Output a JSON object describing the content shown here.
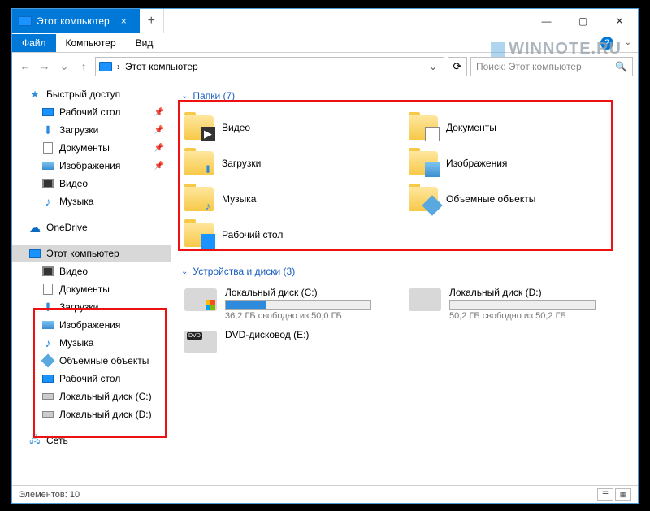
{
  "title": "Этот компьютер",
  "watermark": "WINNOTE.RU",
  "ribbon": {
    "file": "Файл",
    "computer": "Компьютер",
    "view": "Вид"
  },
  "address": {
    "text": "Этот компьютер"
  },
  "search": {
    "placeholder": "Поиск: Этот компьютер"
  },
  "sidebar": {
    "quick": "Быстрый доступ",
    "quick_items": [
      {
        "label": "Рабочий стол"
      },
      {
        "label": "Загрузки"
      },
      {
        "label": "Документы"
      },
      {
        "label": "Изображения"
      },
      {
        "label": "Видео"
      },
      {
        "label": "Музыка"
      }
    ],
    "onedrive": "OneDrive",
    "thispc": "Этот компьютер",
    "pc_items": [
      {
        "label": "Видео"
      },
      {
        "label": "Документы"
      },
      {
        "label": "Загрузки"
      },
      {
        "label": "Изображения"
      },
      {
        "label": "Музыка"
      },
      {
        "label": "Объемные объекты"
      },
      {
        "label": "Рабочий стол"
      }
    ],
    "drives": [
      {
        "label": "Локальный диск (C:)"
      },
      {
        "label": "Локальный диск (D:)"
      }
    ],
    "network": "Сеть"
  },
  "groups": {
    "folders": {
      "title": "Папки (7)",
      "items": [
        {
          "label": "Видео"
        },
        {
          "label": "Документы"
        },
        {
          "label": "Загрузки"
        },
        {
          "label": "Изображения"
        },
        {
          "label": "Музыка"
        },
        {
          "label": "Объемные объекты"
        },
        {
          "label": "Рабочий стол"
        }
      ]
    },
    "drives": {
      "title": "Устройства и диски (3)",
      "items": [
        {
          "label": "Локальный диск (C:)",
          "sub": "36,2 ГБ свободно из 50,0 ГБ",
          "fill": 28
        },
        {
          "label": "Локальный диск (D:)",
          "sub": "50,2 ГБ свободно из 50,2 ГБ",
          "fill": 0
        },
        {
          "label": "DVD-дисковод (E:)",
          "sub": "",
          "fill": -1
        }
      ]
    }
  },
  "status": {
    "text": "Элементов: 10"
  }
}
